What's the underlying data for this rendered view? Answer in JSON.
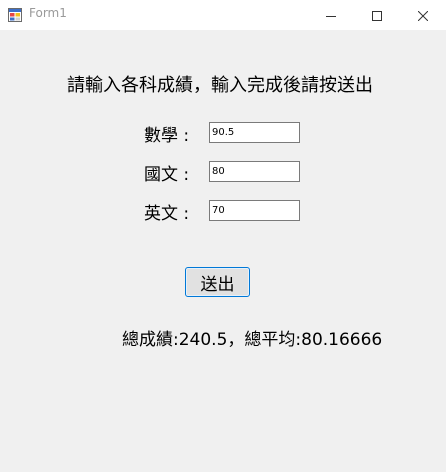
{
  "window": {
    "title": "Form1"
  },
  "form": {
    "instruction": "請輸入各科成績，輸入完成後請按送出",
    "fields": [
      {
        "label": "數學 :",
        "value": "90.5"
      },
      {
        "label": "國文 :",
        "value": "80"
      },
      {
        "label": "英文 :",
        "value": "70"
      }
    ],
    "submit_label": "送出",
    "result": "總成績:240.5，總平均:80.16666"
  }
}
